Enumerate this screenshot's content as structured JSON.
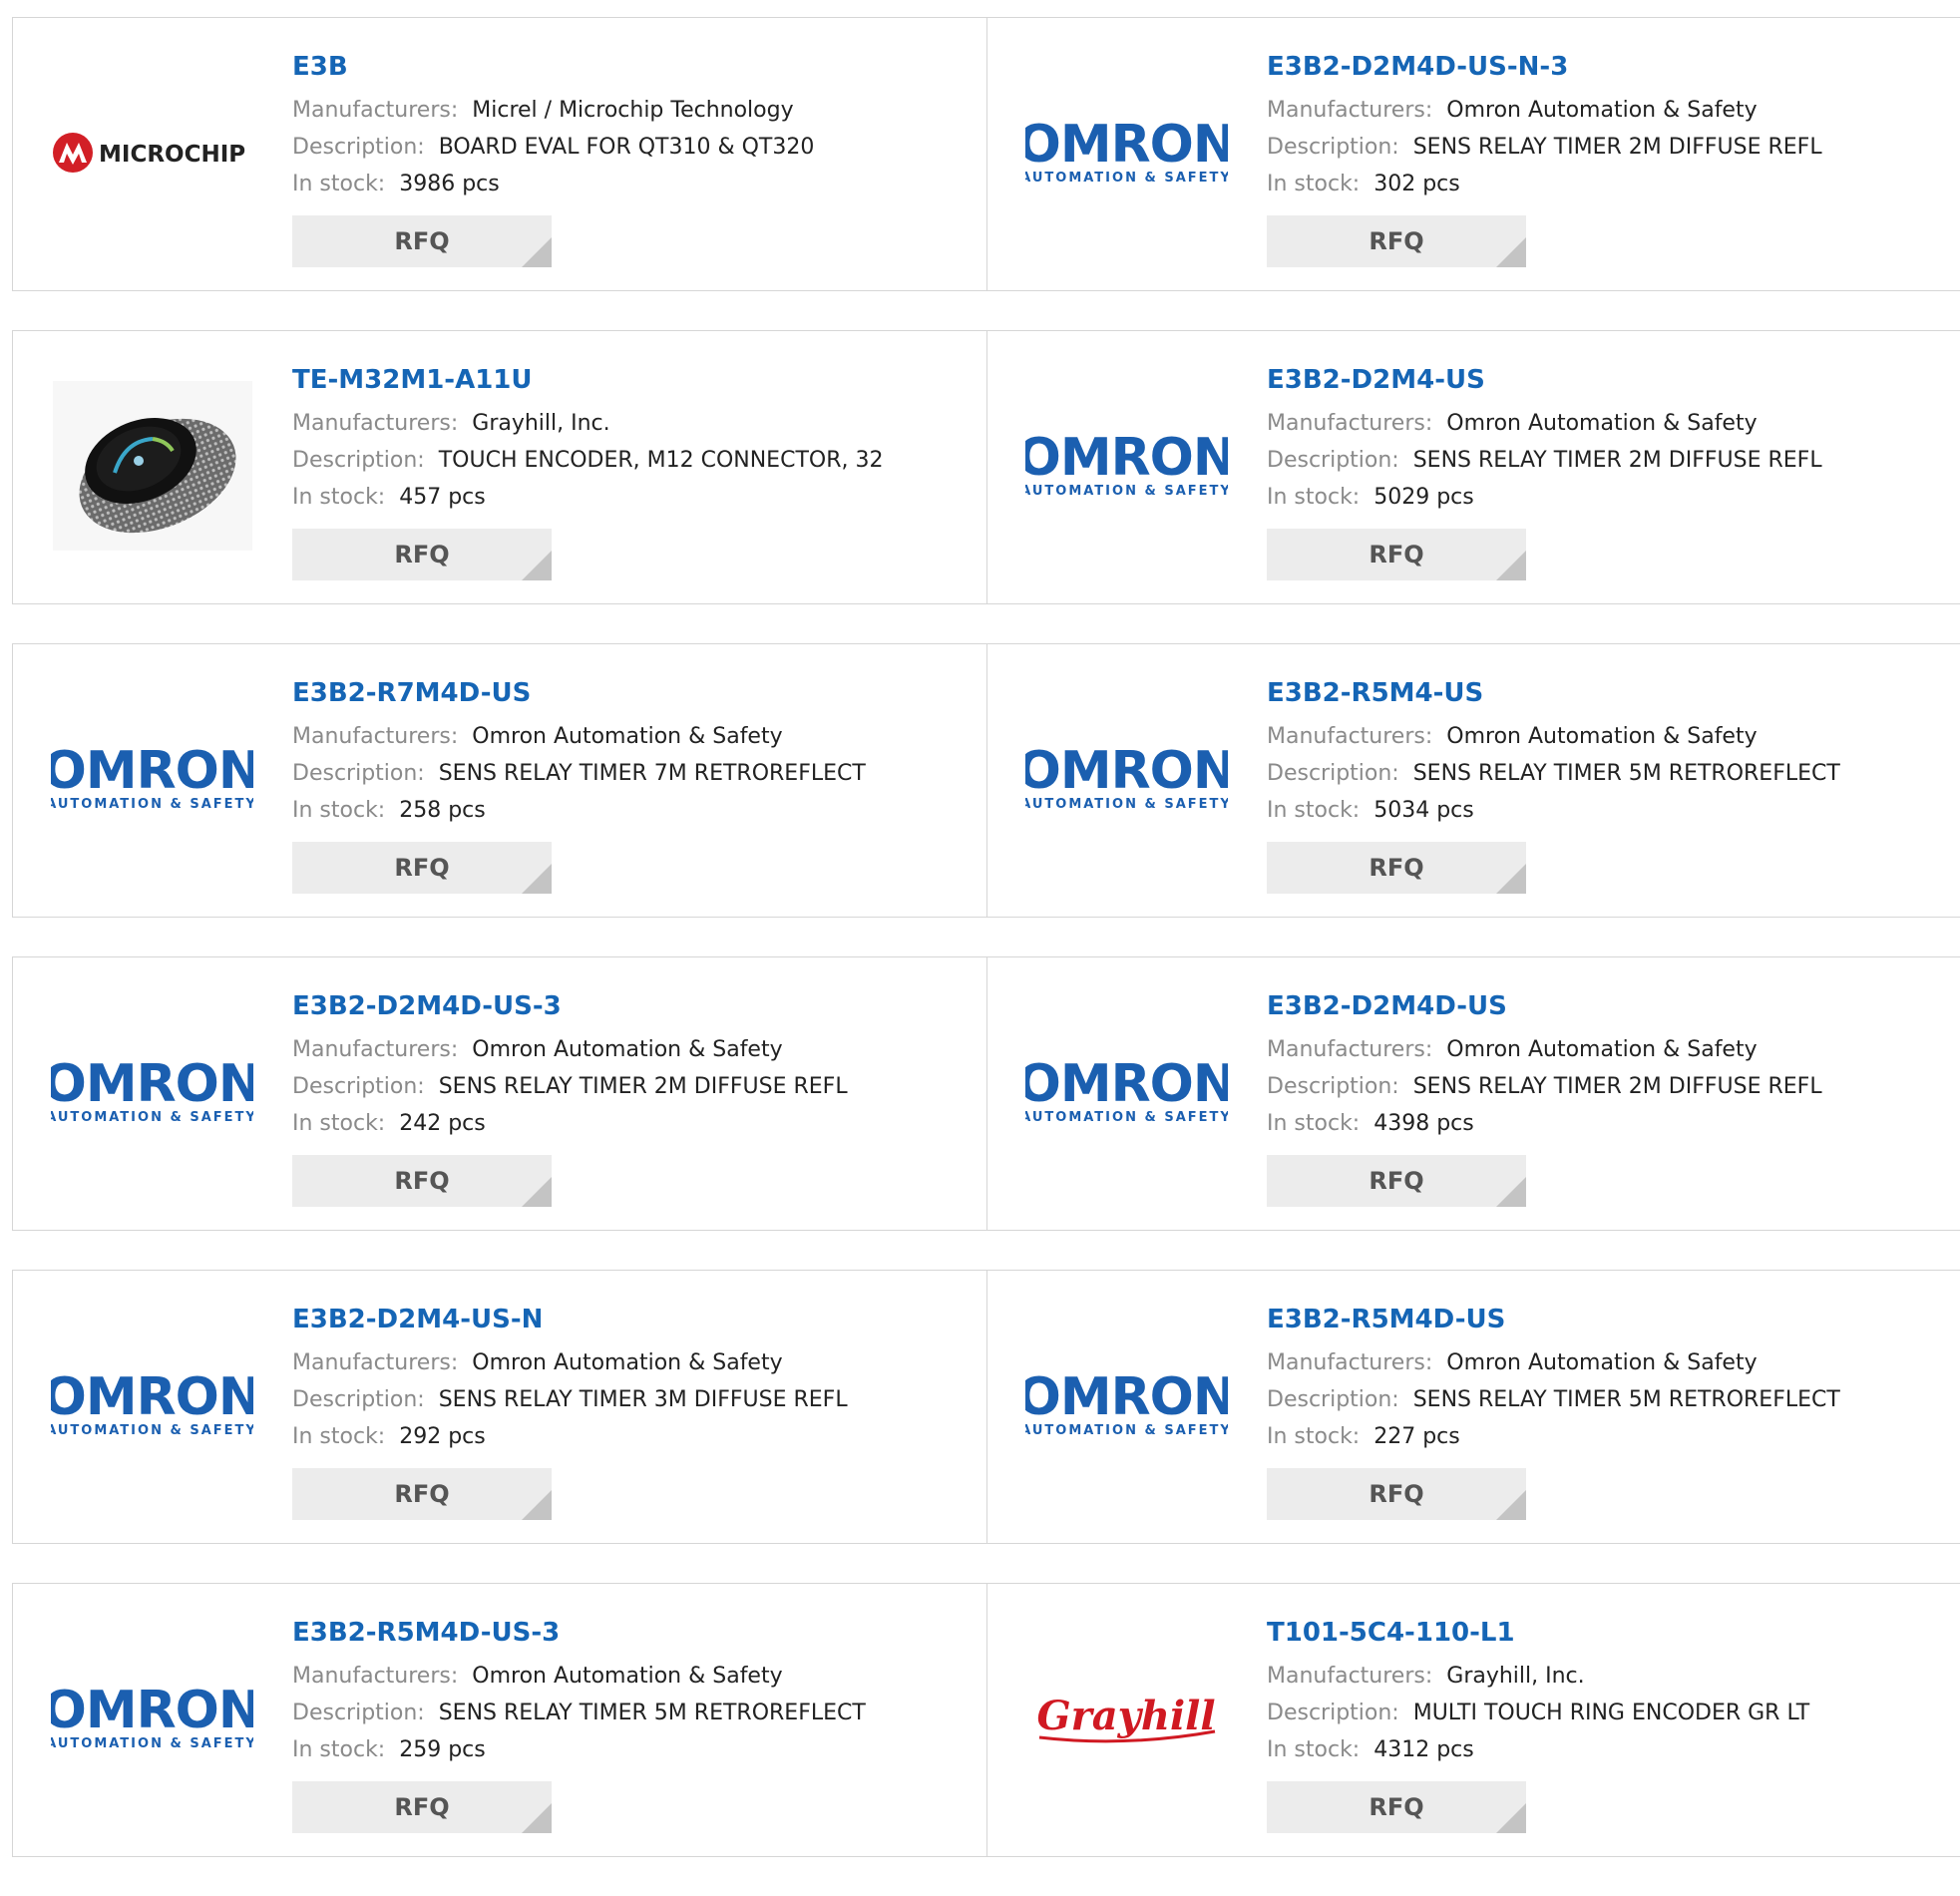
{
  "labels": {
    "manufacturer": "Manufacturers:",
    "description": "Description:",
    "stock": "In stock:",
    "rfq": "RFQ"
  },
  "brands": {
    "microchip": "MICROCHIP",
    "omron": "OMRON",
    "omron_sub": "AUTOMATION & SAFETY",
    "grayhill": "Grayhill"
  },
  "colors": {
    "link": "#1565b5",
    "omron_blue": "#1b5fb0",
    "microchip_red": "#d21f26",
    "grayhill_red": "#d01922"
  },
  "products": [
    {
      "part": "E3B",
      "logo": "microchip",
      "manufacturer": "Micrel / Microchip Technology",
      "description": "BOARD EVAL FOR QT310 & QT320",
      "stock": "3986 pcs"
    },
    {
      "part": "E3B2-D2M4D-US-N-3",
      "logo": "omron",
      "manufacturer": "Omron Automation & Safety",
      "description": "SENS RELAY TIMER 2M DIFFUSE REFL",
      "stock": "302 pcs"
    },
    {
      "part": "TE-M32M1-A11U",
      "logo": "product-photo",
      "manufacturer": "Grayhill, Inc.",
      "description": "TOUCH ENCODER, M12 CONNECTOR, 32",
      "stock": "457 pcs"
    },
    {
      "part": "E3B2-D2M4-US",
      "logo": "omron",
      "manufacturer": "Omron Automation & Safety",
      "description": "SENS RELAY TIMER 2M DIFFUSE REFL",
      "stock": "5029 pcs"
    },
    {
      "part": "E3B2-R7M4D-US",
      "logo": "omron",
      "manufacturer": "Omron Automation & Safety",
      "description": "SENS RELAY TIMER 7M RETROREFLECT",
      "stock": "258 pcs"
    },
    {
      "part": "E3B2-R5M4-US",
      "logo": "omron",
      "manufacturer": "Omron Automation & Safety",
      "description": "SENS RELAY TIMER 5M RETROREFLECT",
      "stock": "5034 pcs"
    },
    {
      "part": "E3B2-D2M4D-US-3",
      "logo": "omron",
      "manufacturer": "Omron Automation & Safety",
      "description": "SENS RELAY TIMER 2M DIFFUSE REFL",
      "stock": "242 pcs"
    },
    {
      "part": "E3B2-D2M4D-US",
      "logo": "omron",
      "manufacturer": "Omron Automation & Safety",
      "description": "SENS RELAY TIMER 2M DIFFUSE REFL",
      "stock": "4398 pcs"
    },
    {
      "part": "E3B2-D2M4-US-N",
      "logo": "omron",
      "manufacturer": "Omron Automation & Safety",
      "description": "SENS RELAY TIMER 3M DIFFUSE REFL",
      "stock": "292 pcs"
    },
    {
      "part": "E3B2-R5M4D-US",
      "logo": "omron",
      "manufacturer": "Omron Automation & Safety",
      "description": "SENS RELAY TIMER 5M RETROREFLECT",
      "stock": "227 pcs"
    },
    {
      "part": "E3B2-R5M4D-US-3",
      "logo": "omron",
      "manufacturer": "Omron Automation & Safety",
      "description": "SENS RELAY TIMER 5M RETROREFLECT",
      "stock": "259 pcs"
    },
    {
      "part": "T101-5C4-110-L1",
      "logo": "grayhill",
      "manufacturer": "Grayhill, Inc.",
      "description": "MULTI TOUCH RING ENCODER GR LT",
      "stock": "4312 pcs"
    }
  ]
}
